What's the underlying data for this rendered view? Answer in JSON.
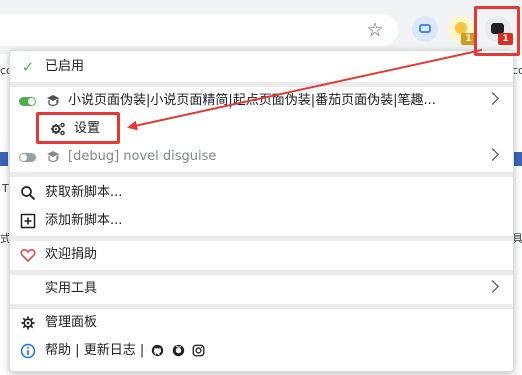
{
  "browser": {
    "star_icon": "star-outline-icon",
    "extensions": [
      {
        "name": "message-extension",
        "badge": ""
      },
      {
        "name": "yellow-extension",
        "badge": "1"
      },
      {
        "name": "violentmonkey-extension",
        "badge": "1"
      }
    ]
  },
  "background": {
    "left_fragment": "co",
    "right_fragment": "co",
    "left_frag2": "T",
    "left_frag3": "式",
    "right_frag3": "具"
  },
  "menu": {
    "enabled_label": "已启用",
    "scripts": [
      {
        "label": "小说页面伪装|小说页面精简|起点页面伪装|番茄页面伪装|笔趣...",
        "enabled": true
      },
      {
        "label": "[debug] novel disguise",
        "enabled": false
      }
    ],
    "settings_label": "设置",
    "get_scripts_label": "获取新脚本...",
    "add_script_label": "添加新脚本...",
    "donate_label": "欢迎捐助",
    "tools_label": "实用工具",
    "dashboard_label": "管理面板",
    "help_label": "帮助",
    "changelog_label": "更新日志",
    "separator": "|"
  },
  "colors": {
    "highlight": "#e53935",
    "toggle_on": "#4caf50",
    "donate_heart": "#e04b4b",
    "info_blue": "#1a73e8"
  }
}
